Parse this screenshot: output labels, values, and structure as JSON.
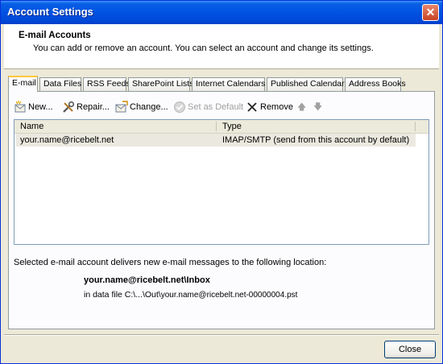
{
  "window": {
    "title": "Account Settings",
    "close_glyph": "✕"
  },
  "header": {
    "title": "E-mail Accounts",
    "description": "You can add or remove an account. You can select an account and change its settings."
  },
  "tabs": [
    {
      "label": "E-mail",
      "active": true
    },
    {
      "label": "Data Files"
    },
    {
      "label": "RSS Feeds"
    },
    {
      "label": "SharePoint Lists"
    },
    {
      "label": "Internet Calendars"
    },
    {
      "label": "Published Calendars"
    },
    {
      "label": "Address Books"
    }
  ],
  "toolbar": {
    "new_label": "New...",
    "repair_label": "Repair...",
    "change_label": "Change...",
    "set_default_label": "Set as Default",
    "remove_label": "Remove",
    "up_glyph": "🡅",
    "down_glyph": "🡇"
  },
  "list": {
    "columns": [
      "Name",
      "Type"
    ],
    "rows": [
      {
        "name": "your.name@ricebelt.net",
        "type": "IMAP/SMTP (send from this account by default)"
      }
    ]
  },
  "delivery": {
    "description": "Selected e-mail account delivers new e-mail messages to the following location:",
    "location": "your.name@ricebelt.net\\Inbox",
    "file_prefix": "in data file C:\\...\\Out\\",
    "file_name": "your.name@ricebelt.net-00000004.pst"
  },
  "buttons": {
    "close": "Close"
  },
  "colors": {
    "titlebar": "#0054e3",
    "face": "#ece9d8",
    "tab_highlight": "#ffc83c",
    "selected_row": "#ebe9df"
  }
}
